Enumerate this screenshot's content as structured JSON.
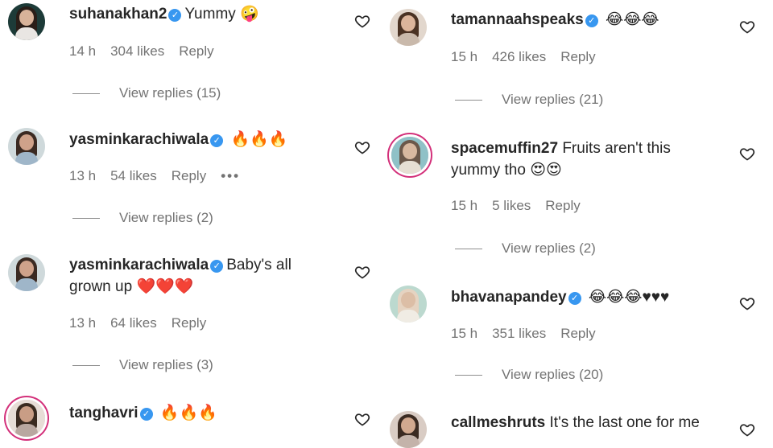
{
  "left_column": [
    {
      "username": "suhanakhan2",
      "verified": true,
      "text": "Yummy",
      "emoji": "🤪",
      "time": "14 h",
      "likes": "304 likes",
      "reply": "Reply",
      "view_replies": "View replies (15)"
    },
    {
      "username": "yasminkarachiwala",
      "verified": true,
      "text": "",
      "emoji": "🔥🔥🔥",
      "time": "13 h",
      "likes": "54 likes",
      "reply": "Reply",
      "more": "•••",
      "view_replies": "View replies (2)"
    },
    {
      "username": "yasminkarachiwala",
      "verified": true,
      "text": "Baby's all",
      "text_line2": "grown up",
      "emoji": "❤️❤️❤️",
      "time": "13 h",
      "likes": "64 likes",
      "reply": "Reply",
      "view_replies": "View replies (3)"
    },
    {
      "username": "tanghavri",
      "verified": true,
      "text": "",
      "emoji": "🔥🔥🔥"
    }
  ],
  "right_column": [
    {
      "username": "tamannaahspeaks",
      "verified": true,
      "text": "",
      "emoji": "😂😂😂",
      "time": "15 h",
      "likes": "426 likes",
      "reply": "Reply",
      "view_replies": "View replies (21)"
    },
    {
      "username": "spacemuffin27",
      "verified": false,
      "text": "Fruits aren't this",
      "text_line2": "yummy tho",
      "emoji": "😍😍",
      "time": "15 h",
      "likes": "5 likes",
      "reply": "Reply",
      "view_replies": "View replies (2)"
    },
    {
      "username": "bhavanapandey",
      "verified": true,
      "text": "",
      "emoji": "😂😂😂♥♥♥",
      "time": "15 h",
      "likes": "351 likes",
      "reply": "Reply",
      "view_replies": "View replies (20)"
    },
    {
      "username": "callmeshruts",
      "verified": false,
      "text": "It's the last one for me",
      "emoji": ""
    }
  ],
  "icons": {
    "like": "heart-outline-icon",
    "verified": "verified-badge-icon"
  },
  "colors": {
    "verified": "#3897f0",
    "story_ring": "#d3307a",
    "meta_gray": "#737373"
  }
}
